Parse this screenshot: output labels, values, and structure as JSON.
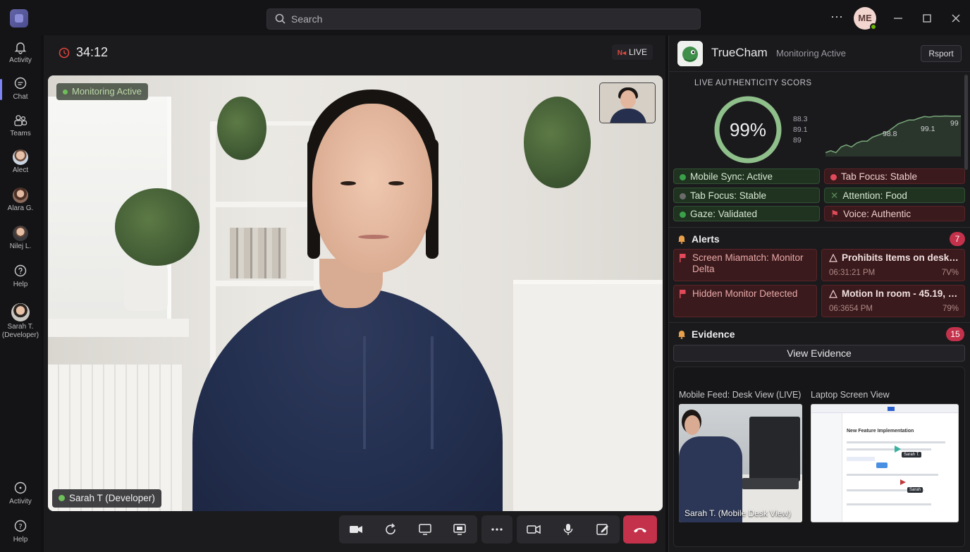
{
  "topbar": {
    "search_placeholder": "Search",
    "avatar_initials": "ME"
  },
  "rail": {
    "items": [
      {
        "label": "Activity",
        "icon": "bell-icon"
      },
      {
        "label": "Chat",
        "icon": "chat-icon"
      },
      {
        "label": "Teams",
        "icon": "teams-icon"
      },
      {
        "label": "Alect",
        "icon": "avatar"
      },
      {
        "label": "Alara G.",
        "icon": "avatar"
      },
      {
        "label": "Nilej L.",
        "icon": "avatar"
      },
      {
        "label": "Help",
        "icon": "help-chat-icon"
      },
      {
        "label": "Sarah T.",
        "sublabel": "(Developer)",
        "icon": "avatar"
      }
    ],
    "bottom_items": [
      {
        "label": "Activity",
        "icon": "activity-chat-icon"
      },
      {
        "label": "Help",
        "icon": "help-icon"
      }
    ]
  },
  "call": {
    "timer": "34:12",
    "live_label": "LIVE",
    "monitoring_badge": "Monitoring Active",
    "participant_name": "Sarah T (Developer)"
  },
  "panel": {
    "title": "TrueCham",
    "subtitle": "Monitoring Active",
    "report_label": "Rsport",
    "score_title": "LIVE AUTHENTICITY SCORS",
    "score_value": "99%",
    "score_fraction": 0.99,
    "mini_values": [
      "88.3",
      "89.1",
      "89"
    ],
    "trend_labels": [
      "98.8",
      "99.1",
      "99"
    ],
    "trend_points": [
      80,
      81,
      80,
      83,
      84,
      83,
      85,
      86,
      86,
      88,
      89,
      90,
      91,
      93,
      95,
      96,
      97,
      97,
      98,
      98.8,
      98.5,
      99,
      98.9,
      99.1,
      99,
      99,
      99
    ],
    "chips": [
      {
        "label": "Mobile Sync: Active",
        "kind": "green",
        "dot": "#3aa04a"
      },
      {
        "label": "Tab Focus: Stable",
        "kind": "red",
        "dot": "#e04a5a"
      },
      {
        "label": "Tab Focus: Stable",
        "kind": "green",
        "dot": "#6a6a6a"
      },
      {
        "label": "Attention: Food",
        "kind": "green",
        "dot": "#4a7a4a"
      },
      {
        "label": "Gaze: Validated",
        "kind": "green",
        "dot": "#3aa04a"
      },
      {
        "label": "Voice: Authentic",
        "kind": "red",
        "dot": "#d03a4a"
      }
    ],
    "alerts_title": "Alerts",
    "alerts_count": "7",
    "alerts": [
      {
        "text": "Screen Miamatch: Monitor Delta",
        "time": "",
        "pct": ""
      },
      {
        "text": "Prohibits Items on desk: I...",
        "time": "06:31:21 PM",
        "pct": "7V%"
      },
      {
        "text": "Hidden Monitor Detected",
        "time": "",
        "pct": ""
      },
      {
        "text": "Motion In room - 45.19, of...",
        "time": "06:3654 PM",
        "pct": "79%"
      }
    ],
    "evidence_title": "Evidence",
    "evidence_count": "15",
    "view_evidence": "View Evidence",
    "mobile_feed_label": "Mobile Feed: Desk View (LIVE)",
    "laptop_label": "Laptop Screen View",
    "mobile_caption": "Sarah T. (Mobile Desk View)",
    "laptop_title": "New Feature Implementation",
    "laptop_tag1": "Sarah T.",
    "laptop_tag2": "Sarah"
  },
  "colors": {
    "accent_red": "#c4314b",
    "accent_green": "#3aa04a",
    "brand": "#6264a7"
  }
}
